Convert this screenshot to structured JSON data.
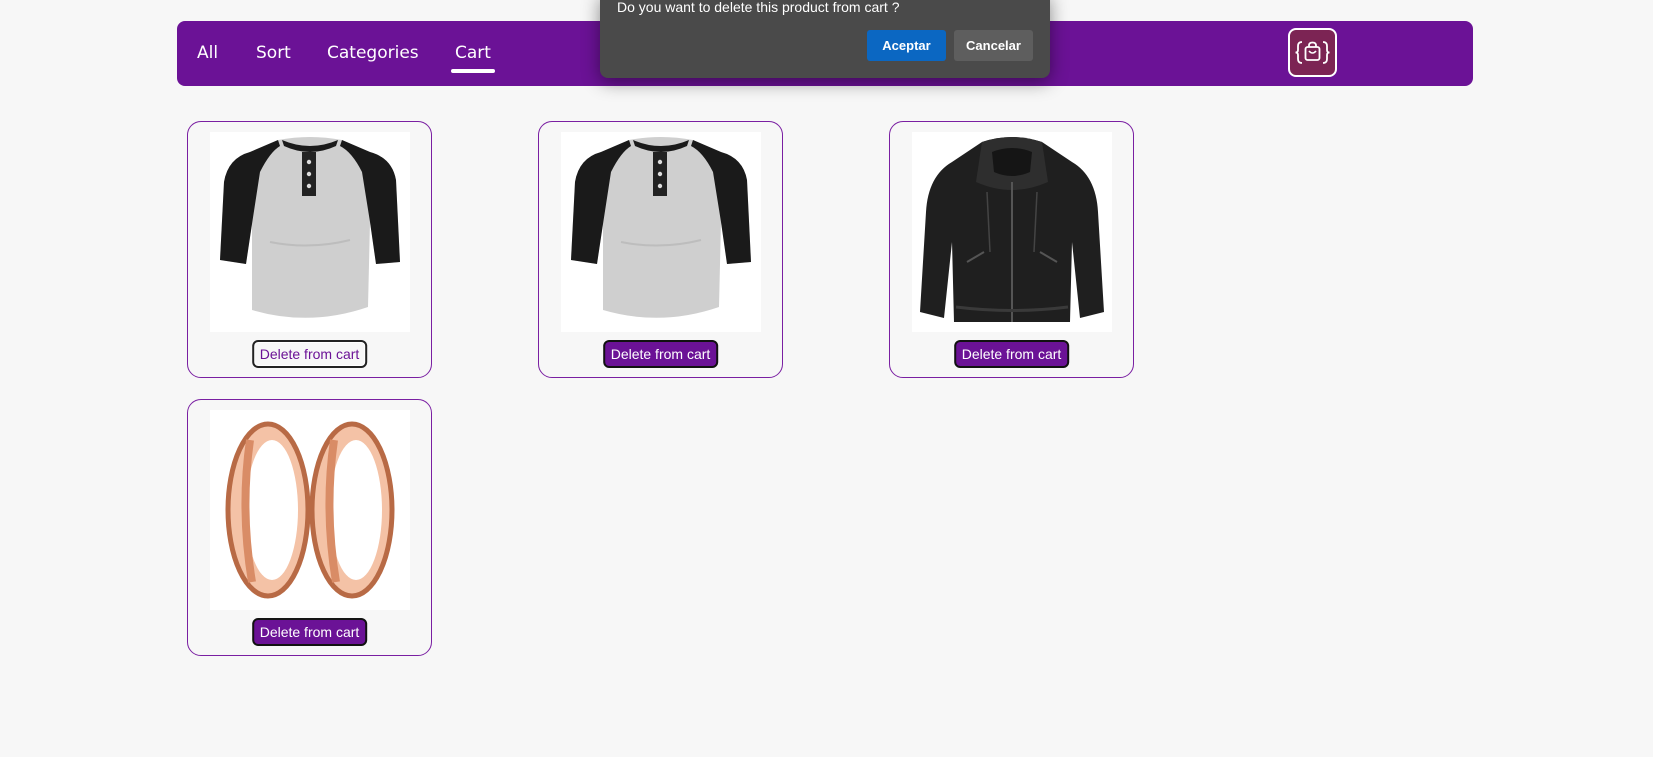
{
  "navbar": {
    "links": [
      {
        "label": "All"
      },
      {
        "label": "Sort"
      },
      {
        "label": "Categories"
      },
      {
        "label": "Cart",
        "active": true
      }
    ],
    "logo_icon": "shopping-bag-code-icon"
  },
  "products": [
    {
      "image_icon": "raglan-henley-shirt-icon",
      "delete_label": "Delete from cart",
      "focused": true
    },
    {
      "image_icon": "raglan-henley-shirt-icon",
      "delete_label": "Delete from cart"
    },
    {
      "image_icon": "leather-jacket-icon",
      "delete_label": "Delete from cart"
    },
    {
      "image_icon": "rose-gold-tunnel-earrings-icon",
      "delete_label": "Delete from cart"
    }
  ],
  "dialog": {
    "message": "Do you want to delete this product from cart ?",
    "accept_label": "Aceptar",
    "cancel_label": "Cancelar"
  },
  "colors": {
    "brand": "#6b1296",
    "accept": "#0b67c2",
    "dialog_bg": "#4a4a4a"
  }
}
